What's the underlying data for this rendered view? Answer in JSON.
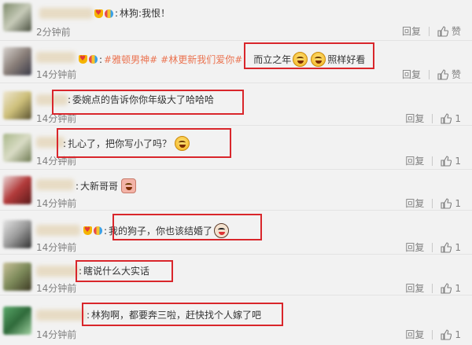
{
  "labels": {
    "reply": "回复",
    "like": "赞"
  },
  "comments": [
    {
      "text": "林狗:我恨！",
      "time": "2分钟前",
      "like_label": "赞"
    },
    {
      "topic1": "#雅顿男神#",
      "topic2": "#林更新我们爱你#",
      "text_a": "而立之年",
      "text_b": "照样好看",
      "time": "14分钟前",
      "like_label": "赞"
    },
    {
      "text": "委婉点的告诉你你年级大了哈哈哈",
      "time": "14分钟前",
      "like_label": "1"
    },
    {
      "text": "扎心了，把你写小了吗？",
      "time": "14分钟前",
      "like_label": "1"
    },
    {
      "text": "大新哥哥",
      "time": "14分钟前",
      "like_label": "1"
    },
    {
      "text": "我的狗子，你也该结婚了",
      "time": "14分钟前",
      "like_label": "1"
    },
    {
      "text": "瞎说什么大实话",
      "time": "14分钟前",
      "like_label": "1"
    },
    {
      "text": "林狗啊，都要奔三啦，赶快找个人嫁了吧",
      "time": "14分钟前",
      "like_label": "1"
    }
  ],
  "icons": {
    "thumb": "thumbs-up-icon",
    "badge_crown": "crown-badge-icon",
    "badge_balloon": "balloon-badge-icon",
    "laugh": "laugh-cry-emoji-icon",
    "grin": "grin-emoji-icon",
    "pig": "pig-emoji-icon",
    "doge": "doge-emoji-icon"
  },
  "colors": {
    "highlight": "#d9262b",
    "topic": "#eb7350",
    "meta": "#808080"
  }
}
